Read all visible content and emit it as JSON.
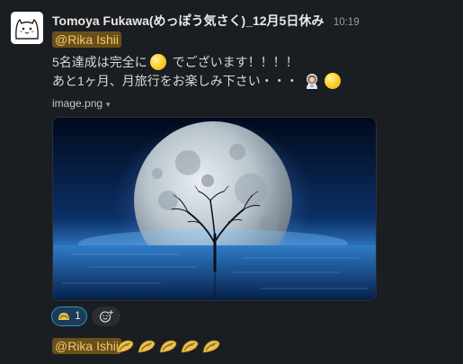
{
  "message": {
    "sender": "Tomoya Fukawa(めっぽう気さく)_12月5日休み",
    "time": "10:19",
    "mention": "@Rika Ishii",
    "line1_before": "5名達成は完全に",
    "line1_after": " でございます！！！！",
    "line2": "あと1ヶ月、月旅行をお楽しみ下さい・・・",
    "file_name": "image.png",
    "file_caret": "▾"
  },
  "reactions": [
    {
      "emoji_icon": "taco-icon",
      "count": "1"
    }
  ],
  "reply": {
    "mention": "@Rika Ishii",
    "taco_count": 5
  }
}
